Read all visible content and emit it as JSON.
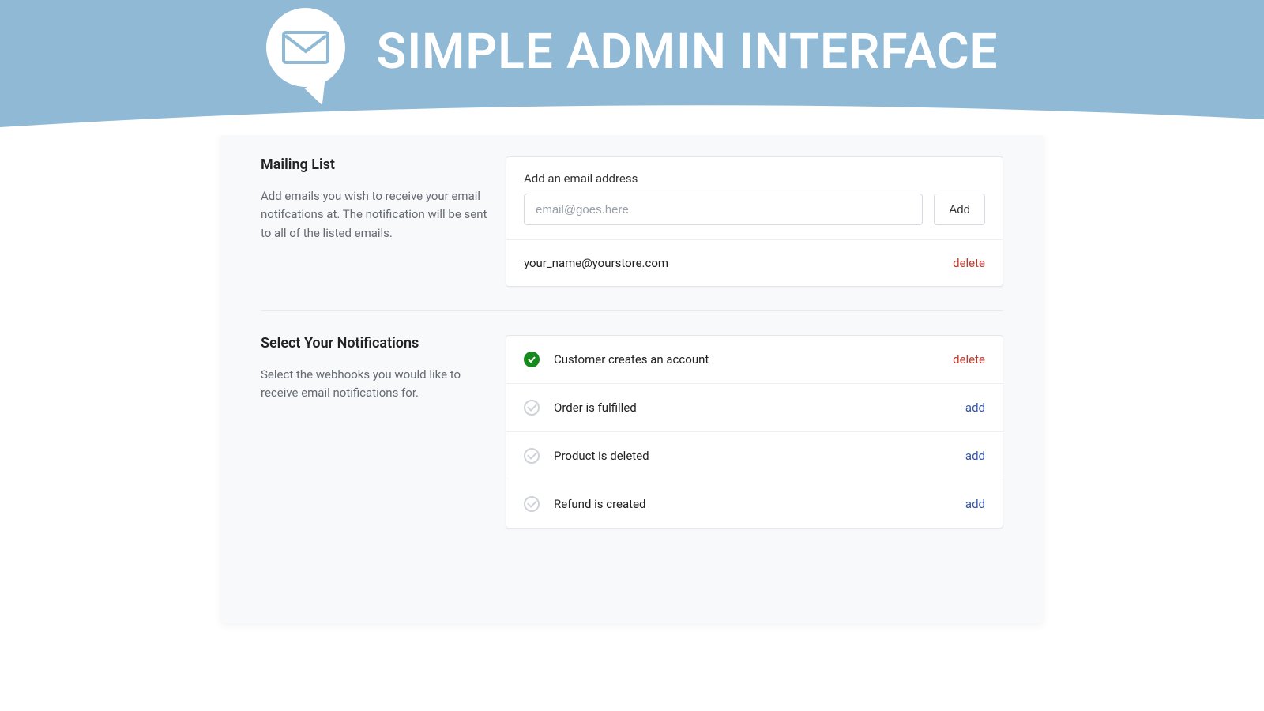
{
  "hero": {
    "title": "SIMPLE ADMIN INTERFACE"
  },
  "mailing": {
    "title": "Mailing List",
    "desc": "Add emails you wish to receive your email notifcations at. The notification will be sent to all of the listed emails.",
    "field_label": "Add an email address",
    "placeholder": "email@goes.here",
    "add_button": "Add",
    "entries": [
      {
        "email": "your_name@yourstore.com",
        "action": "delete"
      }
    ]
  },
  "notifications": {
    "title": "Select Your Notifications",
    "desc": "Select the webhooks you would like to receive email notifications for.",
    "items": [
      {
        "label": "Customer creates an account",
        "selected": true,
        "action": "delete"
      },
      {
        "label": "Order is fulfilled",
        "selected": false,
        "action": "add"
      },
      {
        "label": "Product is deleted",
        "selected": false,
        "action": "add"
      },
      {
        "label": "Refund is created",
        "selected": false,
        "action": "add"
      }
    ]
  }
}
